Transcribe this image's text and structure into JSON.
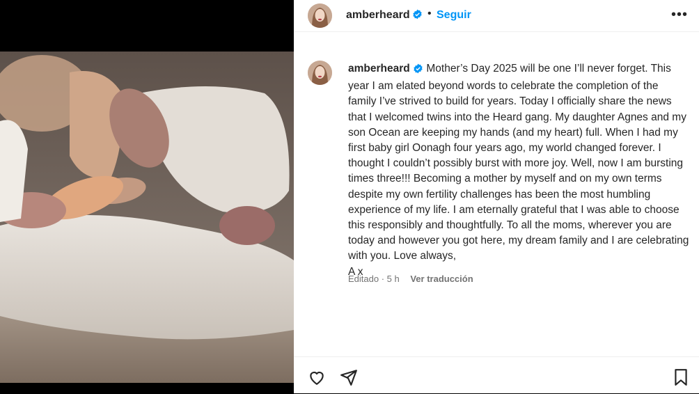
{
  "post": {
    "username": "amberheard",
    "follow_label": "Seguir",
    "separator": "•",
    "more_label": "•••",
    "caption_text": "Mother’s Day 2025 will be one I’ll never forget. This year I am elated beyond words to celebrate the completion of the family I’ve strived to build for years. Today I officially share the news that I welcomed twins into the Heard gang. My daughter Agnes and my son Ocean are keeping my hands (and my heart) full. When I had my first baby girl Oonagh four years ago, my world changed forever. I thought I couldn’t possibly burst with more joy. Well, now I am bursting times three!!! Becoming a mother by myself and on my own terms despite my own fertility challenges has been the most humbling experience of my life. I am eternally grateful that I was able to choose this responsibly and thoughtfully. To all the moms, wherever you are today and however you got here, my dream family and I are celebrating with you. Love always,",
    "caption_signoff": "A x",
    "meta_time": "Editado · 5 h",
    "see_translation": "Ver traducción"
  },
  "icons": {
    "verified": "verified-badge-icon",
    "like": "heart-icon",
    "share": "paper-plane-icon",
    "save": "bookmark-icon",
    "more": "more-options-icon"
  },
  "colors": {
    "accent": "#0095f6",
    "text": "#262626",
    "muted": "#737373"
  }
}
